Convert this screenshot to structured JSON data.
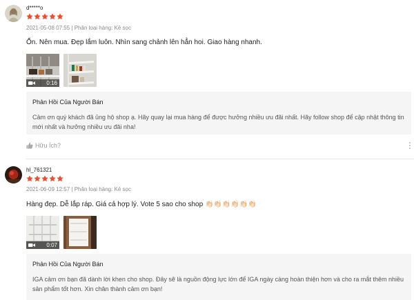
{
  "colors": {
    "star": "#ee4d2d",
    "meta": "#8a8a8a",
    "reply_bg": "#f5f5f5"
  },
  "reviews": [
    {
      "username": "d*****o",
      "rating": 5,
      "date": "2021-05-08 07:55",
      "separator": "|",
      "variant": "Phân loại hàng: Kẻ sọc",
      "comment": "Ổn. Nên mua. Đẹp lắm luôn. Nhìn sang chảnh lên hẳn hoi.  Giao hàng nhanh.",
      "video_duration": "0:16",
      "reply_title": "Phản Hồi Của Người Bán",
      "reply_text": "Cảm ơn quý khách đã ủng hộ shop ạ. Hãy quay lại mua hàng để được hưởng nhiều ưu đãi nhất. Hãy follow shop để cập nhật thông tin mới nhất và hưởng nhiều ưu đãi nha!",
      "helpful_label": "Hữu Ích?"
    },
    {
      "username": "hl_761321",
      "rating": 5,
      "date": "2021-06-09 12:57",
      "separator": "|",
      "variant": "Phân loại hàng: Kẻ sọc",
      "comment": "Hàng đẹp. Dễ lắp ráp. Giá cả hợp lý. Vote 5 sao cho shop 👏🏻👏🏻👏🏻👏🏻👏🏻👏🏻",
      "video_duration": "0:07",
      "reply_title": "Phản Hồi Của Người Bán",
      "reply_text": "IGA cảm ơn bạn đã dành lời khen cho shop. Đây sẽ là nguồn động lực lớn để IGA ngày càng hoàn thiện hơn và cho ra mắt thêm nhiều sản phẩm tốt hơn. Xin chân thành cảm ơn bạn!"
    }
  ]
}
